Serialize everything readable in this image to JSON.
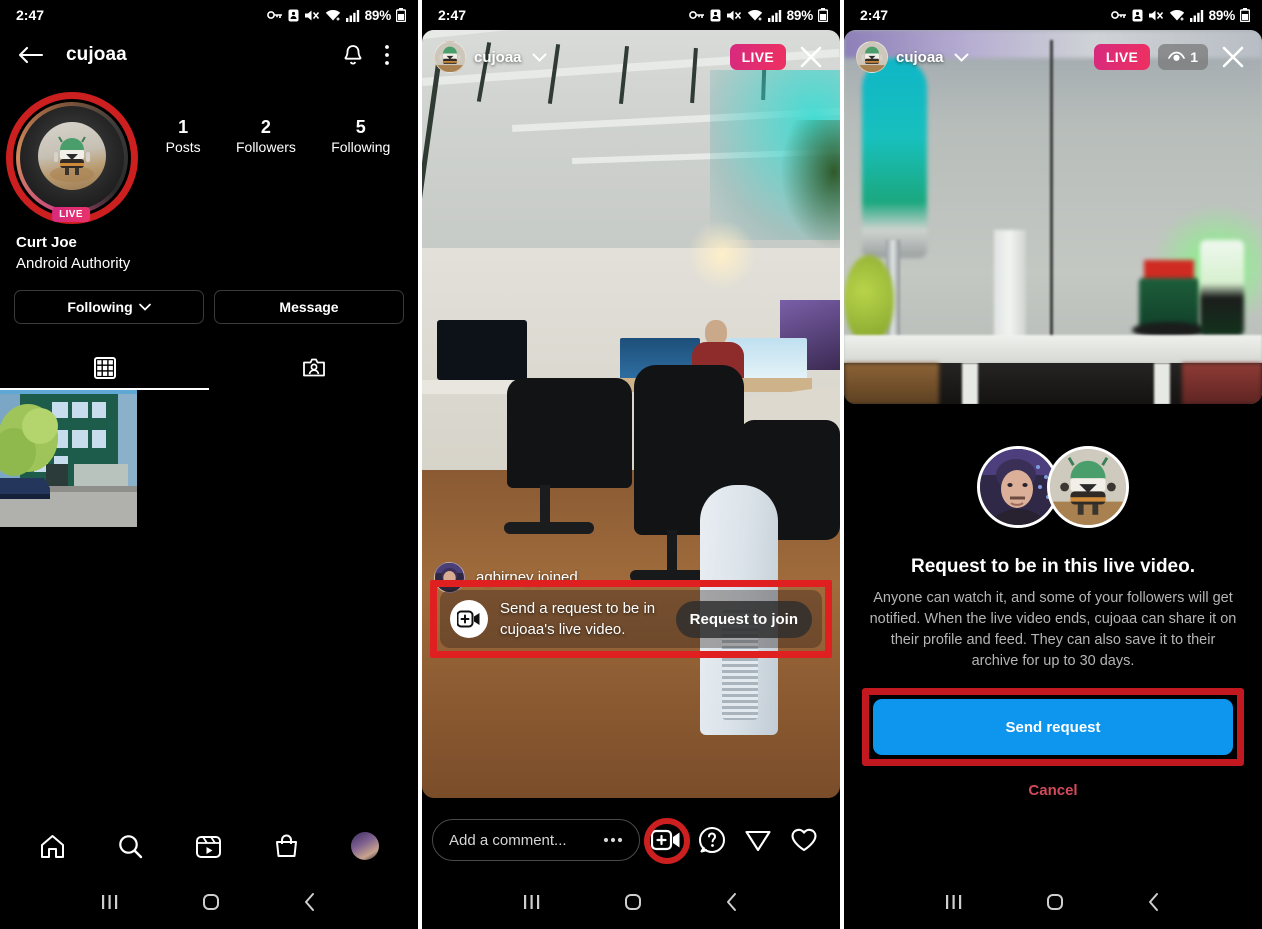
{
  "status_bar": {
    "time": "2:47",
    "battery": "89%",
    "icons": [
      "vpn-key-icon",
      "do-not-disturb-icon",
      "mute-icon",
      "wifi-icon",
      "cellular-signal-icon",
      "battery-icon"
    ]
  },
  "panel1": {
    "header": {
      "back_icon": "back-arrow-icon",
      "title": "cujoaa",
      "notification_icon": "bell-icon",
      "overflow_icon": "more-vertical-icon"
    },
    "profile": {
      "live_badge": "LIVE",
      "name": "Curt Joe",
      "category": "Android Authority",
      "stats": [
        {
          "num": "1",
          "label": "Posts"
        },
        {
          "num": "2",
          "label": "Followers"
        },
        {
          "num": "5",
          "label": "Following"
        }
      ],
      "buttons": {
        "following": "Following",
        "message": "Message"
      },
      "tabs": [
        {
          "name": "grid-tab",
          "icon": "grid-icon",
          "active": true
        },
        {
          "name": "tagged-tab",
          "icon": "tagged-person-icon",
          "active": false
        }
      ]
    },
    "bottom_nav": [
      "home-icon",
      "search-icon",
      "reels-icon",
      "shop-icon",
      "profile-avatar"
    ],
    "system_nav": [
      "recents-icon",
      "home-icon",
      "back-icon"
    ]
  },
  "panel2": {
    "live_header": {
      "username": "cujoaa",
      "chevron_icon": "chevron-down-icon",
      "live_label": "LIVE",
      "close_icon": "close-icon"
    },
    "joined_notice": "agbirney joined",
    "request_card": {
      "icon": "add-video-icon",
      "text": "Send a request to be in cujoaa's live video.",
      "button_label": "Request to join"
    },
    "comment_bar": {
      "placeholder": "Add a comment...",
      "more_icon": "more-horizontal-icon",
      "icons": [
        "add-video-icon",
        "question-icon",
        "send-icon",
        "heart-icon"
      ]
    },
    "system_nav": [
      "recents-icon",
      "home-icon",
      "back-icon"
    ]
  },
  "panel3": {
    "live_header": {
      "username": "cujoaa",
      "chevron_icon": "chevron-down-icon",
      "live_label": "LIVE",
      "viewer_icon": "eye-icon",
      "viewer_count": "1",
      "close_icon": "close-icon"
    },
    "dialog": {
      "title": "Request to be in this live video.",
      "body": "Anyone can watch it, and some of your followers will get notified. When the live video ends, cujoaa can share it on their profile and feed. They can also save it to their archive for up to 30 days.",
      "primary_button": "Send request",
      "cancel_button": "Cancel"
    },
    "system_nav": [
      "recents-icon",
      "home-icon",
      "back-icon"
    ]
  },
  "colors": {
    "highlight_red": "#e02020",
    "instagram_live_pink": "#e8326a",
    "primary_blue": "#0e96ee",
    "cancel_red": "#d24a5a",
    "background": "#000000"
  }
}
